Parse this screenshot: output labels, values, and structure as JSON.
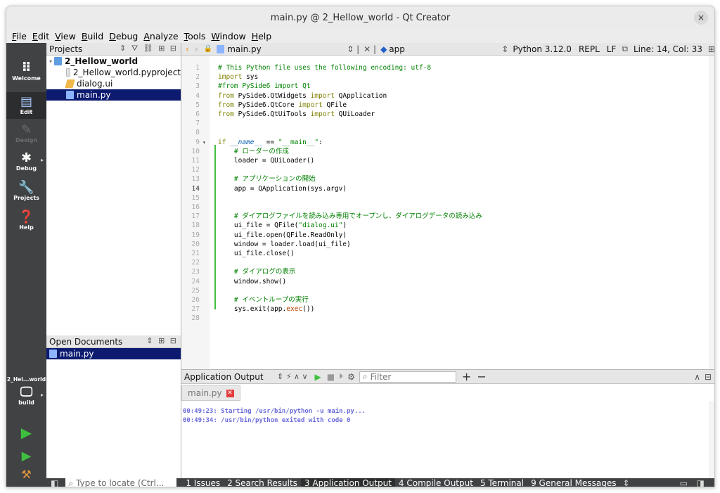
{
  "window": {
    "title": "main.py @ 2_Hellow_world - Qt Creator",
    "close": "×"
  },
  "menu": [
    "File",
    "Edit",
    "View",
    "Build",
    "Debug",
    "Analyze",
    "Tools",
    "Window",
    "Help"
  ],
  "modes": [
    {
      "label": "Welcome",
      "icon": "grid-icon"
    },
    {
      "label": "Edit",
      "icon": "edit-icon"
    },
    {
      "label": "Design",
      "icon": "pencil-icon"
    },
    {
      "label": "Debug",
      "icon": "bug-icon"
    },
    {
      "label": "Projects",
      "icon": "wrench-icon"
    },
    {
      "label": "Help",
      "icon": "help-icon"
    }
  ],
  "kit": {
    "project": "2_Hel...world",
    "config": "build"
  },
  "projects_pane": {
    "title": "Projects",
    "root": "2_Hellow_world",
    "files": [
      "2_Hellow_world.pyproject",
      "dialog.ui",
      "main.py"
    ]
  },
  "open_docs": {
    "title": "Open Documents",
    "files": [
      "main.py"
    ]
  },
  "editor_bar": {
    "file": "main.py",
    "symbol": "app",
    "interpreter": "Python 3.12.0",
    "repl": "REPL",
    "eol": "LF",
    "position": "Line: 14, Col: 33"
  },
  "code_lines": [
    "# This Python file uses the following encoding: utf-8",
    "import sys",
    "#from PySide6 import Qt",
    "from PySide6.QtWidgets import QApplication",
    "from PySide6.QtCore import QFile",
    "from PySide6.QtUiTools import QUiLoader",
    "",
    "",
    "if __name__ == \"__main__\":",
    "    # ローダーの作成",
    "    loader = QUiLoader()",
    "",
    "    # アプリケーションの開始",
    "    app = QApplication(sys.argv)",
    "",
    "",
    "    # ダイアログファイルを読み込み専用でオープンし、ダイアログデータの読み込み",
    "    ui_file = QFile(\"dialog.ui\")",
    "    ui_file.open(QFile.ReadOnly)",
    "    window = loader.load(ui_file)",
    "    ui_file.close()",
    "",
    "    # ダイアログの表示",
    "    window.show()",
    "",
    "    # イベントループの実行",
    "    sys.exit(app.exec())",
    ""
  ],
  "output": {
    "title": "Application Output",
    "filter_placeholder": "Filter",
    "tab": "main.py",
    "lines": [
      "00:49:23: Starting /usr/bin/python -u main.py...",
      "00:49:34: /usr/bin/python exited with code 0"
    ]
  },
  "status": {
    "locator_placeholder": "Type to locate (Ctrl...",
    "tabs": [
      "1 Issues",
      "2 Search Results",
      "3 Application Output",
      "4 Compile Output",
      "5 Terminal",
      "9 General Messages"
    ]
  }
}
